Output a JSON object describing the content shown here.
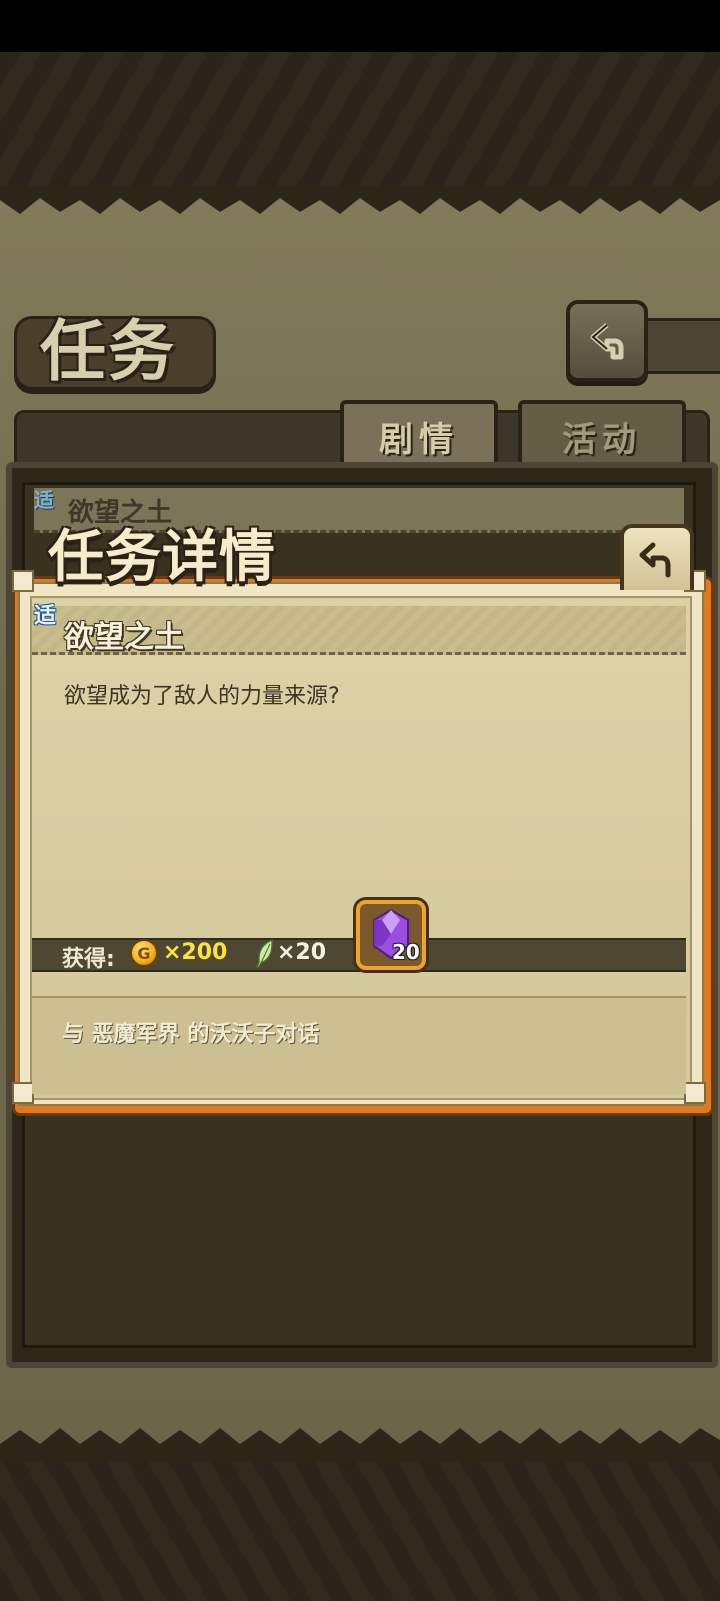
{
  "screen": {
    "title": "任务"
  },
  "tabs": [
    {
      "label": "剧情",
      "selected": true
    },
    {
      "label": "活动",
      "selected": false
    }
  ],
  "quest_list": [
    {
      "badge": "适",
      "label": "欲望之土"
    }
  ],
  "dialog": {
    "title": "任务详情",
    "badge": "适",
    "quest_name": "欲望之土",
    "description": "欲望成为了敌人的力量来源?",
    "rewards": {
      "label": "获得:",
      "coin_symbol": "G",
      "coin_amount": "×200",
      "feather_amount": "×20",
      "gem_amount": "20"
    },
    "objective": "与 恶魔军界 的沃沃子对话"
  },
  "colors": {
    "accent_orange": "#e07a1e",
    "coin_yellow": "#ffe33d",
    "gem_purple": "#9b4fe0",
    "badge_blue": "#7fb3d6"
  },
  "icons": [
    "back-arrow-icon",
    "return-arrow-icon",
    "coin-icon",
    "feather-icon",
    "purple-gem-icon"
  ]
}
